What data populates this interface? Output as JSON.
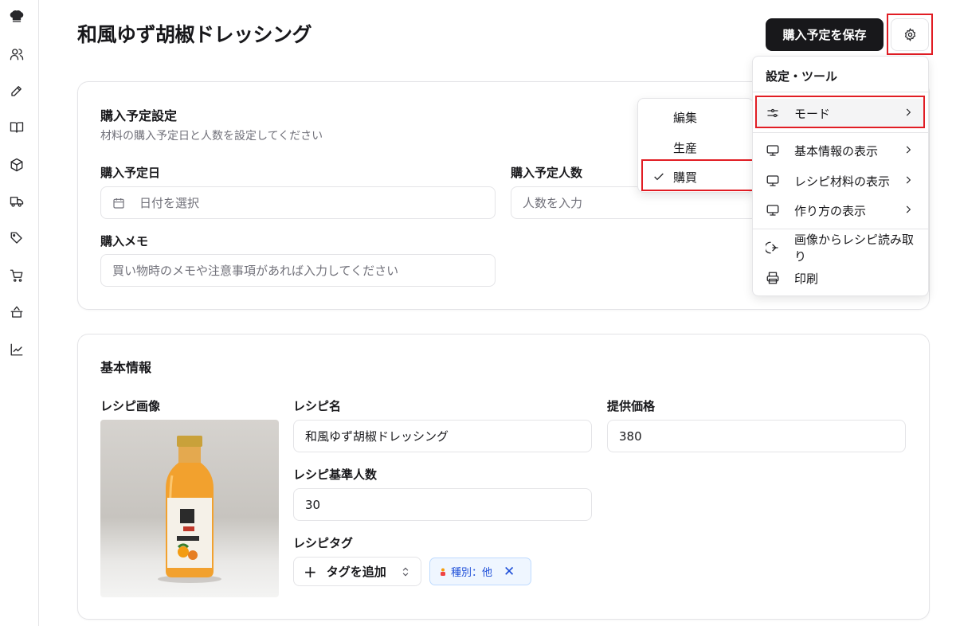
{
  "header": {
    "title": "和風ゆず胡椒ドレッシング",
    "save_label": "購入予定を保存"
  },
  "sidebar": {
    "icons": [
      "chef-hat-icon",
      "users-icon",
      "pen-icon",
      "book-icon",
      "package-icon",
      "truck-icon",
      "tags-icon",
      "cart-icon",
      "cooking-pot-icon",
      "chart-line-icon"
    ]
  },
  "purchase": {
    "title": "購入予定設定",
    "subtitle": "材料の購入予定日と人数を設定してください",
    "date_label": "購入予定日",
    "date_placeholder": "日付を選択",
    "people_label": "購入予定人数",
    "people_placeholder": "人数を入力",
    "memo_label": "購入メモ",
    "memo_placeholder": "買い物時のメモや注意事項があれば入力してください"
  },
  "basic": {
    "title": "基本情報",
    "image_label": "レシピ画像",
    "name_label": "レシピ名",
    "name_value": "和風ゆず胡椒ドレッシング",
    "price_label": "提供価格",
    "price_value": "380",
    "servings_label": "レシピ基準人数",
    "servings_value": "30",
    "tags_label": "レシピタグ",
    "add_tag_label": "タグを追加",
    "tag_chip": "種別：他"
  },
  "settings_menu": {
    "title": "設定・ツール",
    "items": [
      {
        "label": "モード",
        "icon": "sliders-icon"
      },
      {
        "label": "基本情報の表示",
        "icon": "monitor-icon"
      },
      {
        "label": "レシピ材料の表示",
        "icon": "monitor-icon"
      },
      {
        "label": "作り方の表示",
        "icon": "monitor-icon"
      },
      {
        "label": "画像からレシピ読み取り",
        "icon": "scan-icon"
      },
      {
        "label": "印刷",
        "icon": "printer-icon"
      }
    ]
  },
  "mode_submenu": {
    "items": [
      "編集",
      "生産",
      "購買"
    ],
    "selected": "購買"
  },
  "colors": {
    "primary": "#18181b",
    "highlight": "#e11d24",
    "tag_bg": "#eff6ff",
    "tag_text": "#1d4ed8"
  }
}
